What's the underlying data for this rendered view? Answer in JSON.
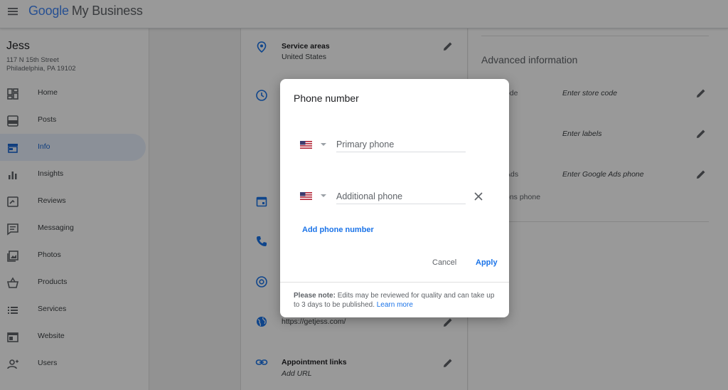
{
  "header": {
    "brand_google": "Google",
    "brand_product": "My Business"
  },
  "business": {
    "name": "Jess",
    "address_line1": "117 N 15th Street",
    "address_line2": "Philadelphia, PA 19102"
  },
  "sidebar": {
    "items": [
      {
        "label": "Home",
        "icon": "dashboard-icon"
      },
      {
        "label": "Posts",
        "icon": "posts-icon"
      },
      {
        "label": "Info",
        "icon": "storefront-icon",
        "active": true
      },
      {
        "label": "Insights",
        "icon": "bar-chart-icon"
      },
      {
        "label": "Reviews",
        "icon": "reviews-icon"
      },
      {
        "label": "Messaging",
        "icon": "chat-icon"
      },
      {
        "label": "Photos",
        "icon": "photos-icon"
      },
      {
        "label": "Products",
        "icon": "basket-icon"
      },
      {
        "label": "Services",
        "icon": "list-icon"
      },
      {
        "label": "Website",
        "icon": "website-icon"
      },
      {
        "label": "Users",
        "icon": "add-user-icon"
      }
    ]
  },
  "main": {
    "service_areas_title": "Service areas",
    "service_areas_value": "United States",
    "website_value": "https://getjess.com/",
    "appointment_title": "Appointment links",
    "appointment_value": "Add URL"
  },
  "advanced": {
    "title": "Advanced information",
    "store_code_label": "ode",
    "store_code_value": "Enter store code",
    "labels_value": "Enter labels",
    "ads_label": "Ads",
    "ads_value": "Enter Google Ads phone",
    "ads_sub_label": "ons phone"
  },
  "dialog": {
    "title": "Phone number",
    "primary_placeholder": "Primary phone",
    "additional_placeholder": "Additional phone",
    "add_link": "Add phone number",
    "cancel": "Cancel",
    "apply": "Apply",
    "note_bold": "Please note:",
    "note_text": " Edits may be reviewed for quality and can take up to 3 days to be published. ",
    "learn_more": "Learn more"
  },
  "colors": {
    "accent": "#1a73e8",
    "active_bg": "#e8f0fe",
    "icon_blue": "#1a73e8"
  }
}
